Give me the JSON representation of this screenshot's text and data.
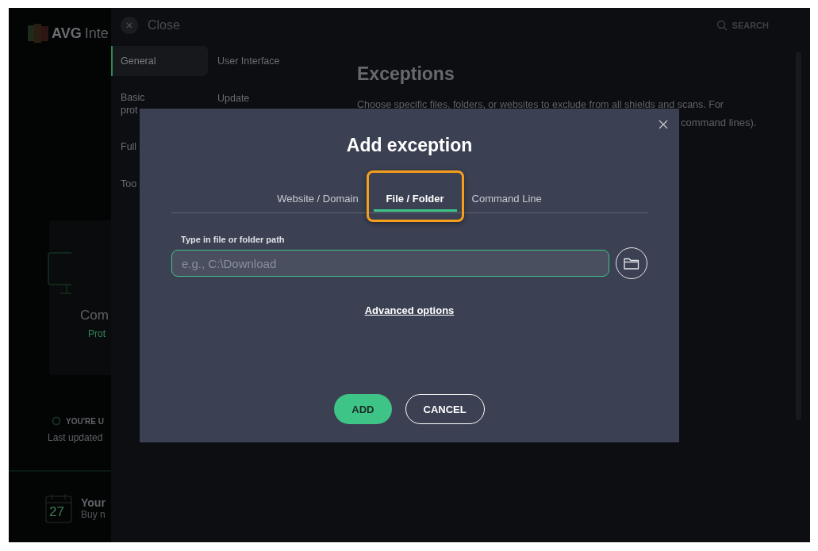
{
  "main_window": {
    "logo_text": "AVG",
    "title": "Inte",
    "card": {
      "title": "Com",
      "status": "Prot"
    },
    "update_status": "YOU'RE U",
    "last_updated": "Last updated",
    "promo": {
      "day": "27",
      "title": "Your",
      "subtitle": "Buy n"
    }
  },
  "settings": {
    "close_label": "Close",
    "search_label": "SEARCH",
    "nav_columns": [
      [
        {
          "label": "General",
          "selected": true
        },
        {
          "label": "Basic\nprot",
          "selected": false
        },
        {
          "label": "Full",
          "selected": false
        },
        {
          "label": "Too",
          "selected": false
        }
      ],
      [
        {
          "label": "User Interface",
          "selected": false
        },
        {
          "label": "Update",
          "selected": false
        }
      ]
    ],
    "heading": "Exceptions",
    "description": "Choose specific files, folders, or websites to exclude from all shields and scans. For",
    "description_tail": "command lines)."
  },
  "dialog": {
    "title": "Add exception",
    "tabs": [
      {
        "label": "Website / Domain",
        "selected": false,
        "highlighted": false
      },
      {
        "label": "File / Folder",
        "selected": true,
        "highlighted": true
      },
      {
        "label": "Command Line",
        "selected": false,
        "highlighted": false
      }
    ],
    "field_label": "Type in file or folder path",
    "placeholder": "e.g., C:\\Download",
    "link": "Advanced options",
    "buttons": [
      {
        "label": "ADD",
        "kind": "primary"
      },
      {
        "label": "CANCEL",
        "kind": "secondary"
      }
    ]
  }
}
